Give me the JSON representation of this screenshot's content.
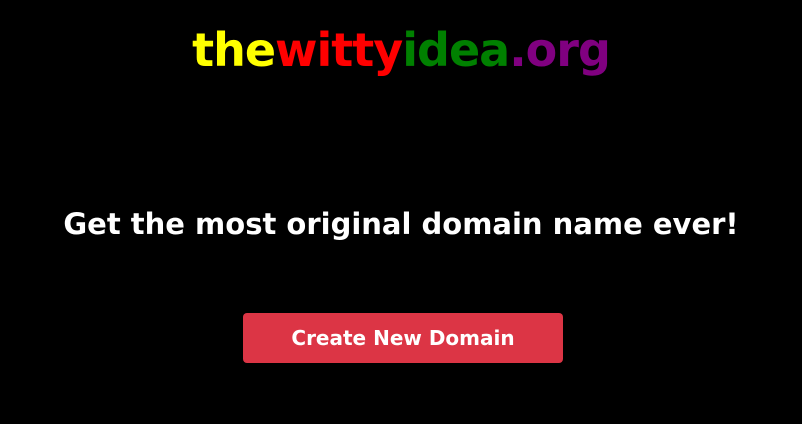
{
  "logo": {
    "parts": [
      {
        "text": "the",
        "color": "#ffff00"
      },
      {
        "text": "witty",
        "color": "#ff0000"
      },
      {
        "text": "idea",
        "color": "#008000"
      },
      {
        "text": ".org",
        "color": "#800080"
      }
    ]
  },
  "main": {
    "tagline": "Get the most original domain name ever!",
    "create_button_label": "Create New Domain",
    "create_button_color": "#dc3545"
  }
}
